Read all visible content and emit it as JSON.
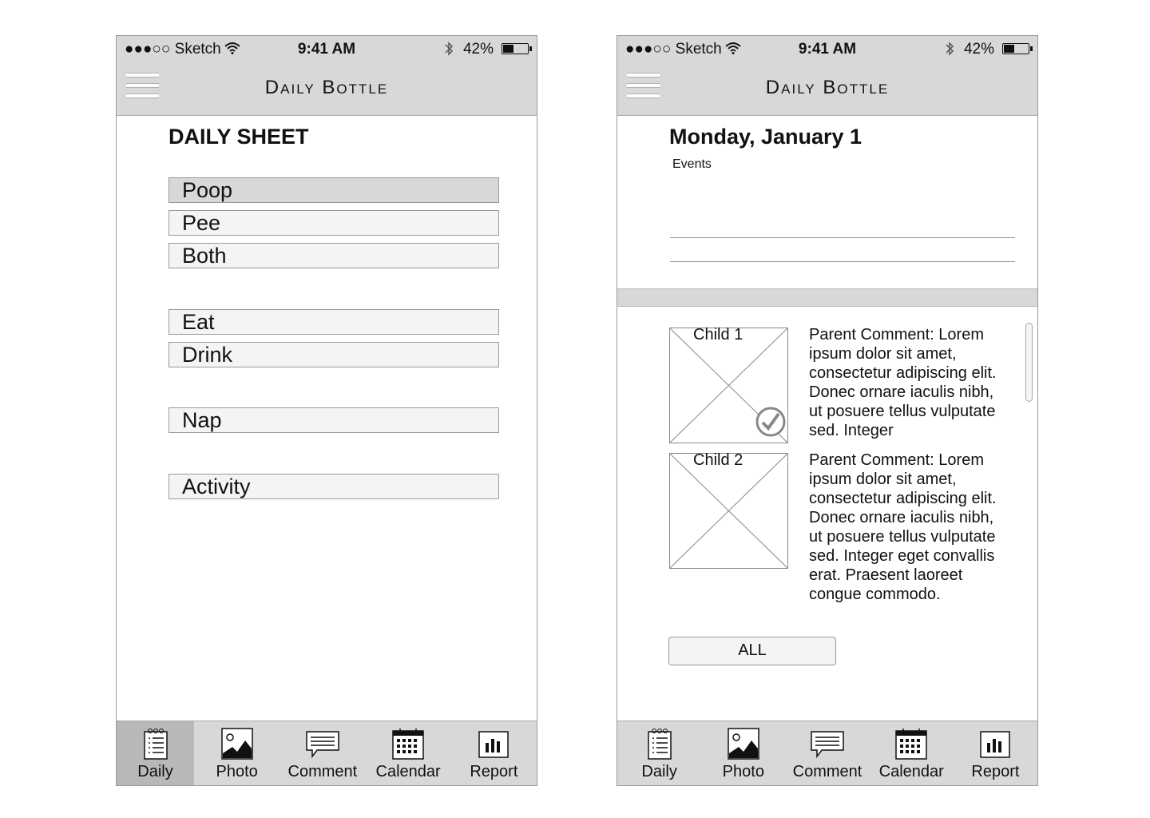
{
  "status_bar": {
    "carrier": "●●●○○ Sketch",
    "time": "9:41 AM",
    "battery": "42%",
    "battery_level": 0.42
  },
  "nav": {
    "title": "Daily Bottle"
  },
  "tabs": [
    {
      "label": "Daily",
      "icon": "daily-sheet-icon"
    },
    {
      "label": "Photo",
      "icon": "photo-icon"
    },
    {
      "label": "Comment",
      "icon": "comment-icon"
    },
    {
      "label": "Calendar",
      "icon": "calendar-icon"
    },
    {
      "label": "Report",
      "icon": "report-icon"
    }
  ],
  "daily_sheet": {
    "title": "DAILY SHEET",
    "options": [
      "Poop",
      "Pee",
      "Both",
      "Eat",
      "Drink",
      "Nap",
      "Activity"
    ],
    "selected": "Poop",
    "active_tab": "Daily"
  },
  "calendar_screen": {
    "date": "Monday, January 1",
    "events_label": "Events",
    "children": [
      {
        "name": "Child 1",
        "comment": "Parent Comment: Lorem ipsum dolor sit amet, consectetur adipiscing elit. Donec ornare iaculis nibh, ut posuere tellus vulputate sed. Integer",
        "checked": true
      },
      {
        "name": "Child 2",
        "comment": "Parent Comment: Lorem ipsum dolor sit amet, consectetur adipiscing elit. Donec ornare iaculis nibh, ut posuere tellus vulputate sed. Integer eget convallis erat. Praesent laoreet congue commodo.",
        "checked": false
      }
    ],
    "all_button": "ALL"
  }
}
